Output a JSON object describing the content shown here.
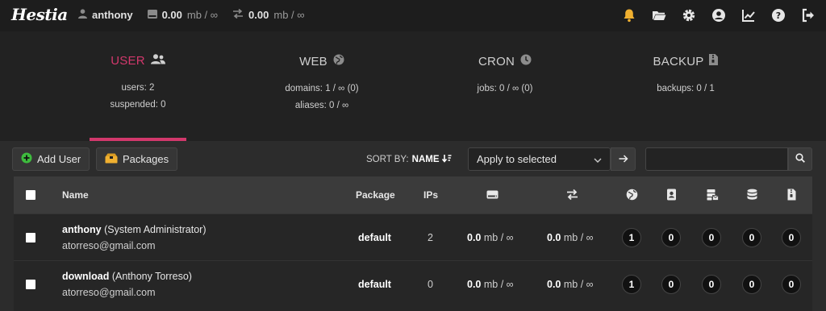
{
  "topbar": {
    "logo": "Hestia",
    "user": "anthony",
    "disk": "0.00",
    "disk_unit": "mb / ∞",
    "bandwidth": "0.00",
    "bandwidth_unit": "mb / ∞",
    "icons": [
      "bell-icon",
      "folder-icon",
      "gear-icon",
      "user-circle-icon",
      "chart-icon",
      "help-icon",
      "logout-icon"
    ],
    "bell_color": "#f0b030"
  },
  "stats": {
    "user": {
      "title": "USER",
      "line1": "users: 2",
      "line2": "suspended: 0"
    },
    "web": {
      "title": "WEB",
      "line1": "domains: 1 / ∞ (0)",
      "line2": "aliases: 0 / ∞"
    },
    "cron": {
      "title": "CRON",
      "line1": "jobs: 0 / ∞ (0)"
    },
    "backup": {
      "title": "BACKUP",
      "line1": "backups: 0 / 1"
    },
    "accent": "#d2386c"
  },
  "toolbar": {
    "add_user": "Add User",
    "packages": "Packages",
    "sort_label": "SORT BY:",
    "sort_value": "NAME",
    "bulk_action": "Apply to selected",
    "search_placeholder": ""
  },
  "table": {
    "headers": {
      "name": "Name",
      "package": "Package",
      "ips": "IPs"
    },
    "header_icons": [
      "disk-icon",
      "bandwidth-icon",
      "globe-icon",
      "address-book-icon",
      "mail-server-icon",
      "database-icon",
      "backup-file-icon"
    ],
    "rows": [
      {
        "username": "anthony",
        "fullname": "(System Administrator)",
        "email": "atorreso@gmail.com",
        "package": "default",
        "ips": "2",
        "disk": "0.0",
        "disk_unit": "mb / ∞",
        "bw": "0.0",
        "bw_unit": "mb / ∞",
        "web": "1",
        "dns": "0",
        "mail": "0",
        "db": "0",
        "backup": "0"
      },
      {
        "username": "download",
        "fullname": "(Anthony Torreso)",
        "email": "atorreso@gmail.com",
        "package": "default",
        "ips": "0",
        "disk": "0.0",
        "disk_unit": "mb / ∞",
        "bw": "0.0",
        "bw_unit": "mb / ∞",
        "web": "1",
        "dns": "0",
        "mail": "0",
        "db": "0",
        "backup": "0"
      }
    ]
  }
}
